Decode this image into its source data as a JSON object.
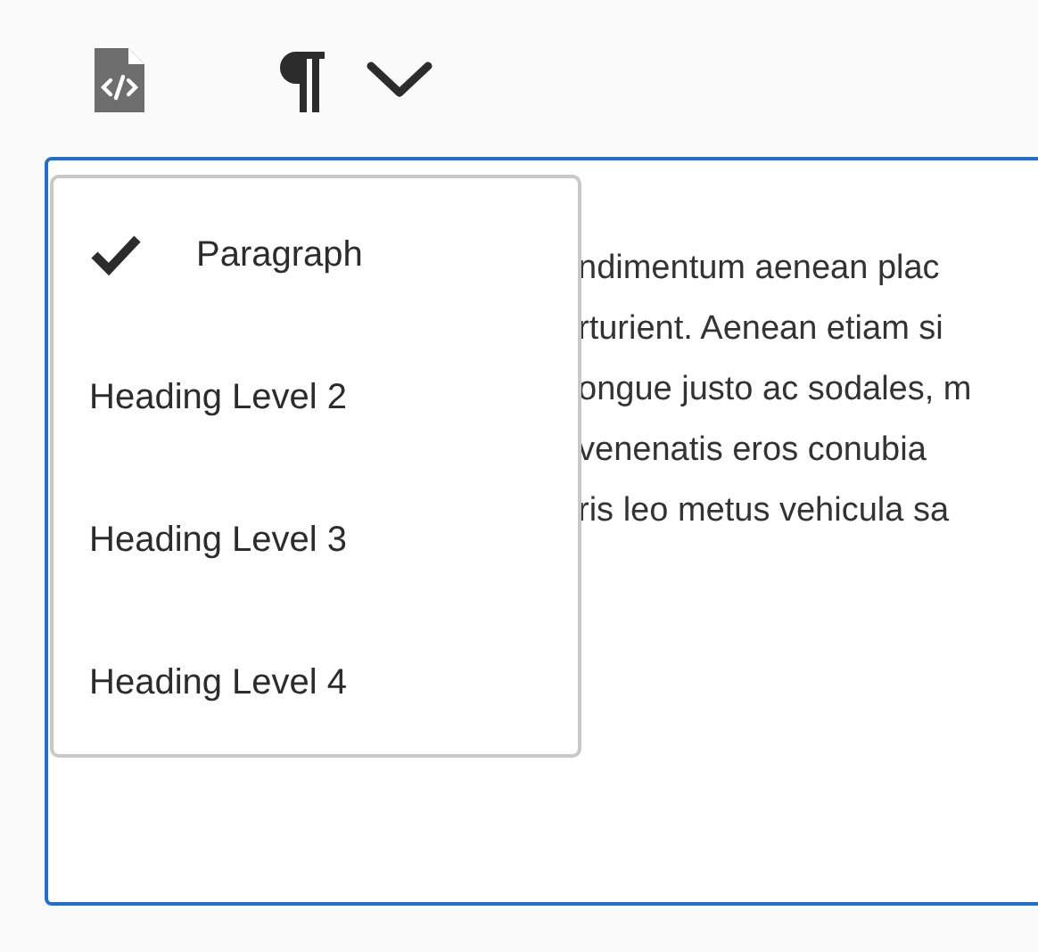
{
  "toolbar": {
    "buttons": [
      {
        "kind": "source"
      },
      {
        "kind": "paragraph"
      }
    ]
  },
  "editor": {
    "lines": [
      "ndimentum aenean plac",
      "rturient. Aenean etiam si",
      "ongue justo ac sodales, m",
      "venenatis eros conubia",
      "ris leo metus vehicula sa"
    ]
  },
  "menu": {
    "items": [
      {
        "label": "Paragraph",
        "selected": true
      },
      {
        "label": "Heading Level 2",
        "selected": false
      },
      {
        "label": "Heading Level 3",
        "selected": false
      },
      {
        "label": "Heading Level 4",
        "selected": false
      }
    ]
  }
}
